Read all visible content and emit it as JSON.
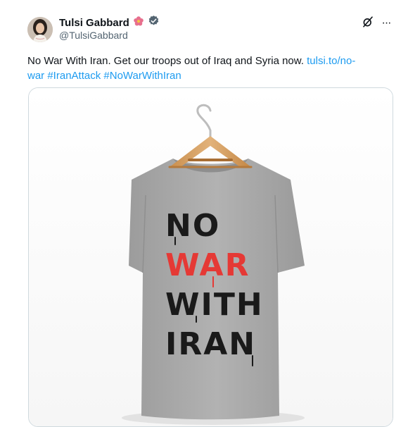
{
  "author": {
    "display_name": "Tulsi Gabbard",
    "handle": "@TulsiGabbard",
    "verified": true,
    "flower_emoji_icon": "flower-icon"
  },
  "tweet": {
    "text_plain": "No War With Iran. Get our troops out of Iraq and Syria now. ",
    "link_part1": "tulsi.to/no-",
    "link_part2": "war",
    "hashtag1": "#IranAttack",
    "hashtag2": "#NoWarWithIran"
  },
  "actions": {
    "grok_icon": "grok-icon",
    "more_label": "···"
  },
  "media": {
    "shirt_line1": "NO",
    "shirt_line2": "WAR",
    "shirt_line3": "WITH",
    "shirt_line4": "IRAN"
  },
  "colors": {
    "link": "#1d9bf0",
    "shirt": "#a9a9a9",
    "red_text": "#e53935",
    "dark_text": "#1a1a1a"
  }
}
